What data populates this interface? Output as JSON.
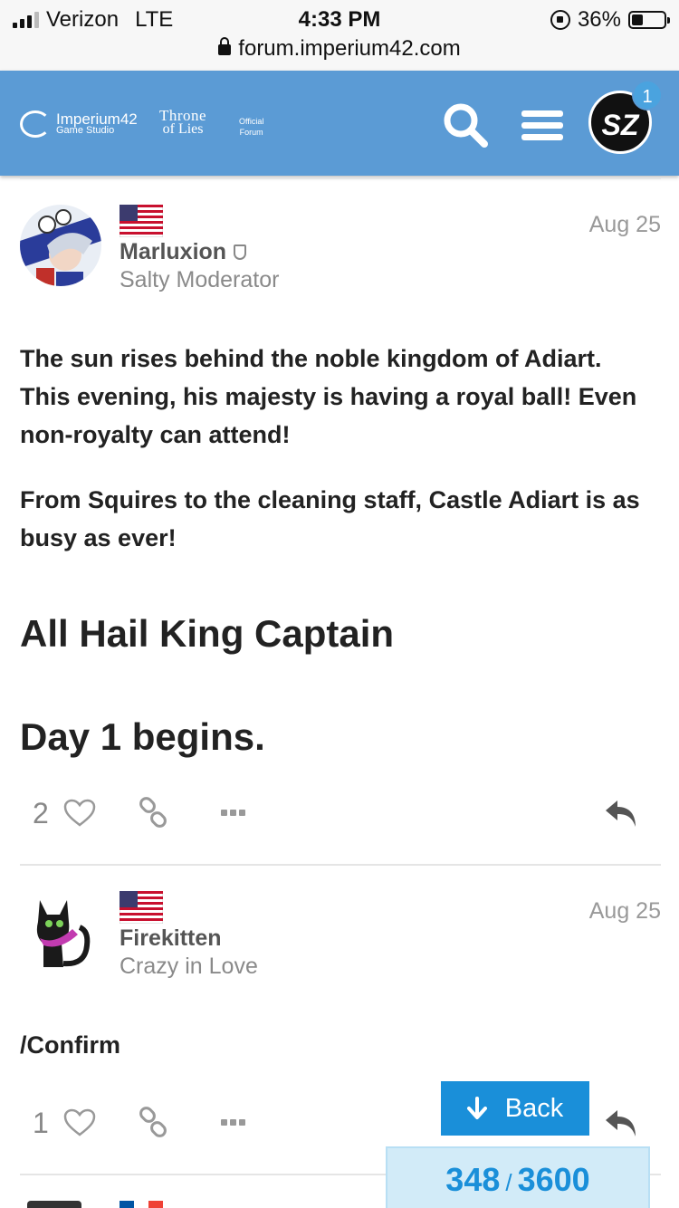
{
  "status_bar": {
    "carrier": "Verizon",
    "network": "LTE",
    "time": "4:33 PM",
    "battery": "36%",
    "battery_level": 0.36,
    "url": "forum.imperium42.com"
  },
  "header": {
    "studio_name": "Imperium42",
    "studio_sub": "Game Studio",
    "game_name_top": "Throne",
    "game_name_bottom": "of Lies",
    "forum_label_top": "Official",
    "forum_label_bottom": "Forum",
    "avatar_initials": "SZ",
    "notification_count": "1",
    "accent_color": "#5b9bd5"
  },
  "posts": [
    {
      "username": "Marluxion",
      "user_title": "Salty Moderator",
      "date": "Aug 25",
      "paragraphs": [
        "The sun rises behind the noble kingdom of Adiart. This evening, his majesty is having a royal ball! Even non-royalty can attend!",
        "From Squires to the cleaning staff, Castle Adiart is as busy as ever!"
      ],
      "heading1": "All Hail King Captain",
      "heading2": "Day 1 begins.",
      "likes": "2"
    },
    {
      "username": "Firekitten",
      "user_title": "Crazy in Love",
      "date": "Aug 25",
      "body": "/Confirm",
      "likes": "1"
    }
  ],
  "back_button": "Back",
  "progress": {
    "current": "348",
    "separator": "/",
    "total": "3600"
  }
}
